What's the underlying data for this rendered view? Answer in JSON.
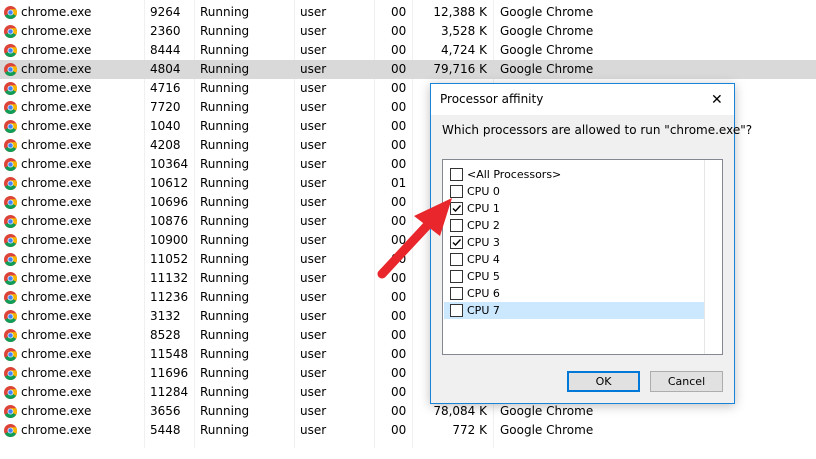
{
  "processes": [
    {
      "name": "chrome.exe",
      "pid": "9264",
      "status": "Running",
      "user": "user",
      "cpu": "00",
      "mem": "12,388 K",
      "desc": "Google Chrome"
    },
    {
      "name": "chrome.exe",
      "pid": "2360",
      "status": "Running",
      "user": "user",
      "cpu": "00",
      "mem": "3,528 K",
      "desc": "Google Chrome"
    },
    {
      "name": "chrome.exe",
      "pid": "8444",
      "status": "Running",
      "user": "user",
      "cpu": "00",
      "mem": "4,724 K",
      "desc": "Google Chrome"
    },
    {
      "name": "chrome.exe",
      "pid": "4804",
      "status": "Running",
      "user": "user",
      "cpu": "00",
      "mem": "79,716 K",
      "desc": "Google Chrome",
      "selected": true
    },
    {
      "name": "chrome.exe",
      "pid": "4716",
      "status": "Running",
      "user": "user",
      "cpu": "00",
      "mem": "",
      "desc": ""
    },
    {
      "name": "chrome.exe",
      "pid": "7720",
      "status": "Running",
      "user": "user",
      "cpu": "00",
      "mem": "",
      "desc": ""
    },
    {
      "name": "chrome.exe",
      "pid": "1040",
      "status": "Running",
      "user": "user",
      "cpu": "00",
      "mem": "",
      "desc": ""
    },
    {
      "name": "chrome.exe",
      "pid": "4208",
      "status": "Running",
      "user": "user",
      "cpu": "00",
      "mem": "",
      "desc": ""
    },
    {
      "name": "chrome.exe",
      "pid": "10364",
      "status": "Running",
      "user": "user",
      "cpu": "00",
      "mem": "",
      "desc": ""
    },
    {
      "name": "chrome.exe",
      "pid": "10612",
      "status": "Running",
      "user": "user",
      "cpu": "01",
      "mem": "",
      "desc": ""
    },
    {
      "name": "chrome.exe",
      "pid": "10696",
      "status": "Running",
      "user": "user",
      "cpu": "00",
      "mem": "",
      "desc": ""
    },
    {
      "name": "chrome.exe",
      "pid": "10876",
      "status": "Running",
      "user": "user",
      "cpu": "00",
      "mem": "",
      "desc": ""
    },
    {
      "name": "chrome.exe",
      "pid": "10900",
      "status": "Running",
      "user": "user",
      "cpu": "00",
      "mem": "",
      "desc": ""
    },
    {
      "name": "chrome.exe",
      "pid": "11052",
      "status": "Running",
      "user": "user",
      "cpu": "00",
      "mem": "",
      "desc": ""
    },
    {
      "name": "chrome.exe",
      "pid": "11132",
      "status": "Running",
      "user": "user",
      "cpu": "00",
      "mem": "",
      "desc": ""
    },
    {
      "name": "chrome.exe",
      "pid": "11236",
      "status": "Running",
      "user": "user",
      "cpu": "00",
      "mem": "",
      "desc": ""
    },
    {
      "name": "chrome.exe",
      "pid": "3132",
      "status": "Running",
      "user": "user",
      "cpu": "00",
      "mem": "",
      "desc": ""
    },
    {
      "name": "chrome.exe",
      "pid": "8528",
      "status": "Running",
      "user": "user",
      "cpu": "00",
      "mem": "",
      "desc": ""
    },
    {
      "name": "chrome.exe",
      "pid": "11548",
      "status": "Running",
      "user": "user",
      "cpu": "00",
      "mem": "",
      "desc": ""
    },
    {
      "name": "chrome.exe",
      "pid": "11696",
      "status": "Running",
      "user": "user",
      "cpu": "00",
      "mem": "",
      "desc": ""
    },
    {
      "name": "chrome.exe",
      "pid": "11284",
      "status": "Running",
      "user": "user",
      "cpu": "00",
      "mem": "",
      "desc": ""
    },
    {
      "name": "chrome.exe",
      "pid": "3656",
      "status": "Running",
      "user": "user",
      "cpu": "00",
      "mem": "78,084 K",
      "desc": "Google Chrome"
    },
    {
      "name": "chrome.exe",
      "pid": "5448",
      "status": "Running",
      "user": "user",
      "cpu": "00",
      "mem": "772 K",
      "desc": "Google Chrome"
    },
    {
      "name": "",
      "pid": "",
      "status": "",
      "user": "",
      "cpu": "",
      "mem": "",
      "desc": ""
    }
  ],
  "dialog": {
    "title": "Processor affinity",
    "question": "Which processors are allowed to run \"chrome.exe\"?",
    "items": [
      {
        "label": "<All Processors>",
        "checked": false
      },
      {
        "label": "CPU 0",
        "checked": false
      },
      {
        "label": "CPU 1",
        "checked": true
      },
      {
        "label": "CPU 2",
        "checked": false
      },
      {
        "label": "CPU 3",
        "checked": true
      },
      {
        "label": "CPU 4",
        "checked": false
      },
      {
        "label": "CPU 5",
        "checked": false
      },
      {
        "label": "CPU 6",
        "checked": false
      },
      {
        "label": "CPU 7",
        "checked": false,
        "highlighted": true
      }
    ],
    "ok_label": "OK",
    "cancel_label": "Cancel"
  },
  "icons": {
    "process_icon": "chrome-icon",
    "close": "close-icon",
    "annotation": "red-arrow-icon"
  },
  "colors": {
    "selected_row": "#d9d9d9",
    "dialog_border": "#1883d7",
    "list_highlight": "#cce8ff",
    "arrow": "#e8262b"
  }
}
